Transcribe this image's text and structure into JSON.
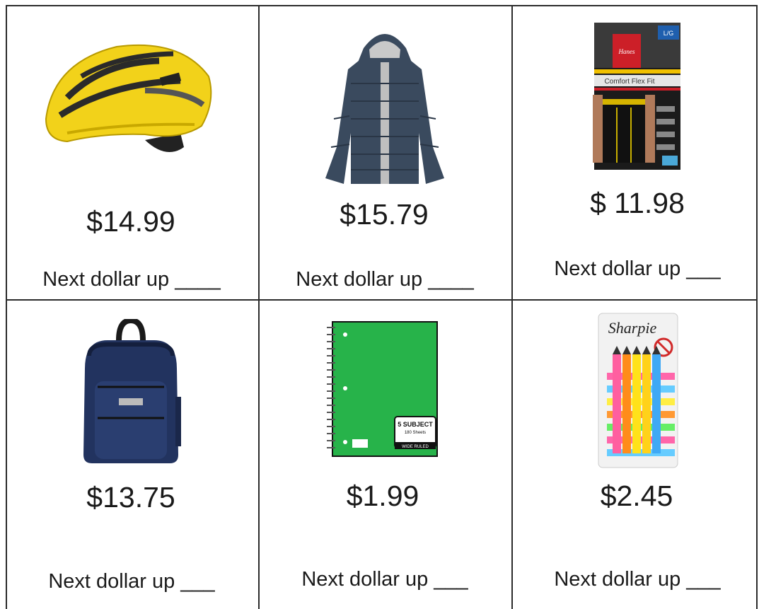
{
  "worksheet": {
    "items": [
      {
        "name": "bike helmet",
        "icon": "bike-helmet-icon",
        "price": "$14.99",
        "prompt": "Next dollar up ____"
      },
      {
        "name": "puffer jacket",
        "icon": "puffer-jacket-icon",
        "price": "$15.79",
        "prompt": "Next dollar up ____"
      },
      {
        "name": "boxer brief pack",
        "icon": "underwear-pack-icon",
        "price": "$ 11.98",
        "prompt": "Next dollar up ___",
        "package": {
          "brand": "Hanes",
          "size": "L/G",
          "product": "Comfort Flex Fit"
        }
      },
      {
        "name": "backpack",
        "icon": "backpack-icon",
        "price": "$13.75",
        "prompt": "Next dollar up ___"
      },
      {
        "name": "spiral notebook",
        "icon": "spiral-notebook-icon",
        "price": "$1.99",
        "prompt": "Next dollar up ___",
        "package": {
          "label": "5 SUBJECT",
          "sublabel": "180 Sheets",
          "rule": "WIDE RULED"
        }
      },
      {
        "name": "highlighter pack",
        "icon": "highlighter-pack-icon",
        "price": "$2.45",
        "prompt": "Next dollar up ___",
        "package": {
          "brand": "Sharpie"
        }
      }
    ]
  },
  "colors": {
    "helmet": "#f2d21a",
    "jacket": "#3a4a5e",
    "backpack": "#22335f",
    "notebook": "#27b34a",
    "grid": "#2b2b2b"
  }
}
